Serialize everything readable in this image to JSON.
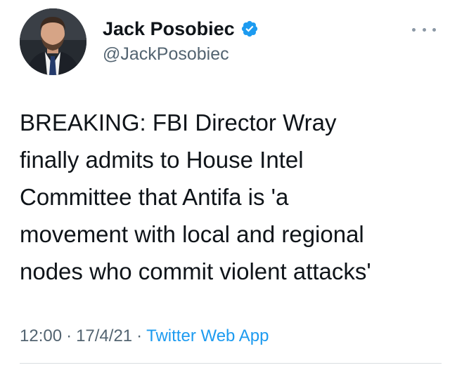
{
  "author": {
    "display_name": "Jack Posobiec",
    "handle": "@JackPosobiec",
    "verified": true,
    "avatar_icon": "profile-photo"
  },
  "tweet": {
    "text_lines": [
      "BREAKING: FBI Director Wray",
      "finally admits to House Intel",
      "Committee that Antifa is 'a",
      "movement with local and regional",
      "nodes who commit violent attacks'"
    ]
  },
  "meta": {
    "time": "12:00",
    "date": "17/4/21",
    "separator": "·",
    "source": "Twitter Web App"
  },
  "icons": {
    "verified": "verified-badge-icon",
    "more": "more-options-icon"
  },
  "colors": {
    "text": "#0f1419",
    "secondary": "#536471",
    "link": "#1d9bf0",
    "verified": "#1d9bf0"
  }
}
